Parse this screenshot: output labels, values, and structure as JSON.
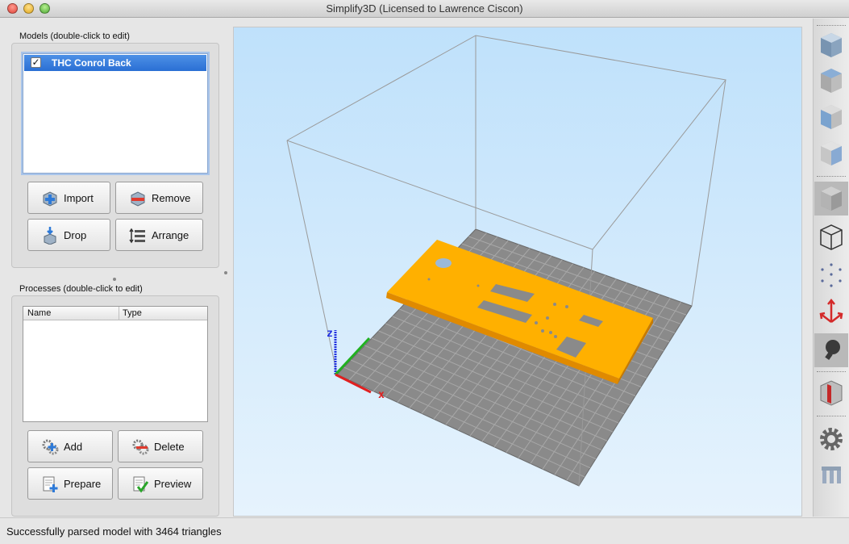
{
  "window": {
    "title": "Simplify3D (Licensed to Lawrence Ciscon)"
  },
  "models": {
    "label": "Models (double-click to edit)",
    "items": [
      {
        "name": "THC Conrol Back",
        "checked": true
      }
    ],
    "buttons": {
      "import": "Import",
      "remove": "Remove",
      "drop": "Drop",
      "arrange": "Arrange"
    }
  },
  "processes": {
    "label": "Processes (double-click to edit)",
    "columns": [
      "Name",
      "Type"
    ],
    "buttons": {
      "add": "Add",
      "delete": "Delete",
      "prepare": "Prepare",
      "preview": "Preview"
    }
  },
  "viewport": {
    "axis_labels": {
      "x": "x",
      "z": "z"
    },
    "colors": {
      "background_top": "#bfe1fb",
      "bed": "#8a8a8a",
      "model": "#ffb300",
      "x_axis": "#e02020",
      "y_axis": "#20b020",
      "z_axis": "#2030e0"
    }
  },
  "toolbar": {
    "icons": [
      "view-default-icon",
      "view-top-icon",
      "view-front-icon",
      "view-side-icon",
      "solid-mode-icon",
      "wireframe-mode-icon",
      "points-mode-icon",
      "axes-toggle-icon",
      "lighting-icon",
      "cross-section-icon",
      "settings-gear-icon",
      "supports-icon"
    ]
  },
  "status": {
    "message": "Successfully parsed model with 3464 triangles"
  }
}
